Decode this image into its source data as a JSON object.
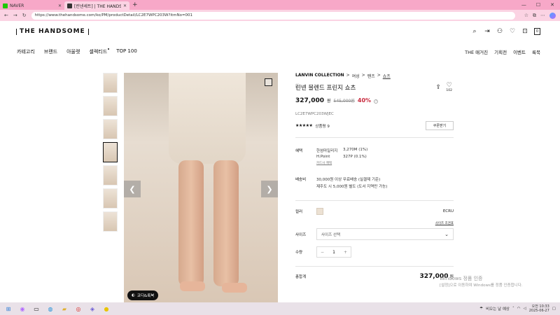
{
  "browser": {
    "tabs": [
      {
        "title": "NAVER"
      },
      {
        "title": "[린넨세트] | THE HANDSOME.CO..."
      }
    ],
    "new_tab": "+",
    "url": "https://www.thehandsome.com/ko/PM/productDetail/LC2E7WPC203W?itmNo=001",
    "nav": {
      "back": "←",
      "forward": "→",
      "reload": "↻"
    }
  },
  "site": {
    "logo": "THE HANDSOME",
    "gnb": [
      "카테고리",
      "브랜드",
      "아울렛",
      "셀렉티드",
      "TOP 100"
    ],
    "gnb_right": [
      "THE 매거진",
      "기획전",
      "이벤트",
      "룩북"
    ],
    "cart_count": "0"
  },
  "gallery": {
    "thumb_count": 7,
    "selected_index": 3,
    "coordi_label": "코디&룩북"
  },
  "product": {
    "brand": "LANVIN COLLECTION",
    "crumbs": [
      "여성",
      "팬츠",
      "쇼츠"
    ],
    "name": "린넨 블렌드 프린지 쇼츠",
    "like_count": "102",
    "price": "327,000",
    "currency": "원",
    "original_price": "545,000원",
    "discount": "40%",
    "code": "LC2E7WPC203WJEC",
    "stars": "★★★★★",
    "review_label": "상품평 9",
    "coupon_label": "쿠폰받기",
    "benefit": {
      "label": "혜택",
      "rows": [
        {
          "name": "한섬마일리지",
          "value": "3,270M (1%)"
        },
        {
          "name": "H.Point",
          "value": "327P (0.1%)"
        }
      ],
      "link": "카드사 혜택"
    },
    "shipping": {
      "label": "배송비",
      "lines": [
        "30,000원 이상 무료배송 (실결제 기준)",
        "제주도 시 5,000원 별도 (도서 지역만 가능)"
      ]
    },
    "color": {
      "label": "컬러",
      "name": "ECRU"
    },
    "size_guide": "사이즈 조견표",
    "size": {
      "label": "사이즈",
      "placeholder": "사이즈 선택"
    },
    "quantity": {
      "label": "수량",
      "value": "1",
      "minus": "−",
      "plus": "+"
    },
    "total": {
      "label": "총합계",
      "value": "327,000",
      "currency": "원"
    }
  },
  "watermark": {
    "title": "Windows 정품 인증",
    "sub": "[설정]으로 이동하여 Windows를 정품 인증합니다."
  },
  "taskbar": {
    "weather": "비오는 날 예상",
    "time": "오전 10:33",
    "date": "2025-06-27"
  }
}
